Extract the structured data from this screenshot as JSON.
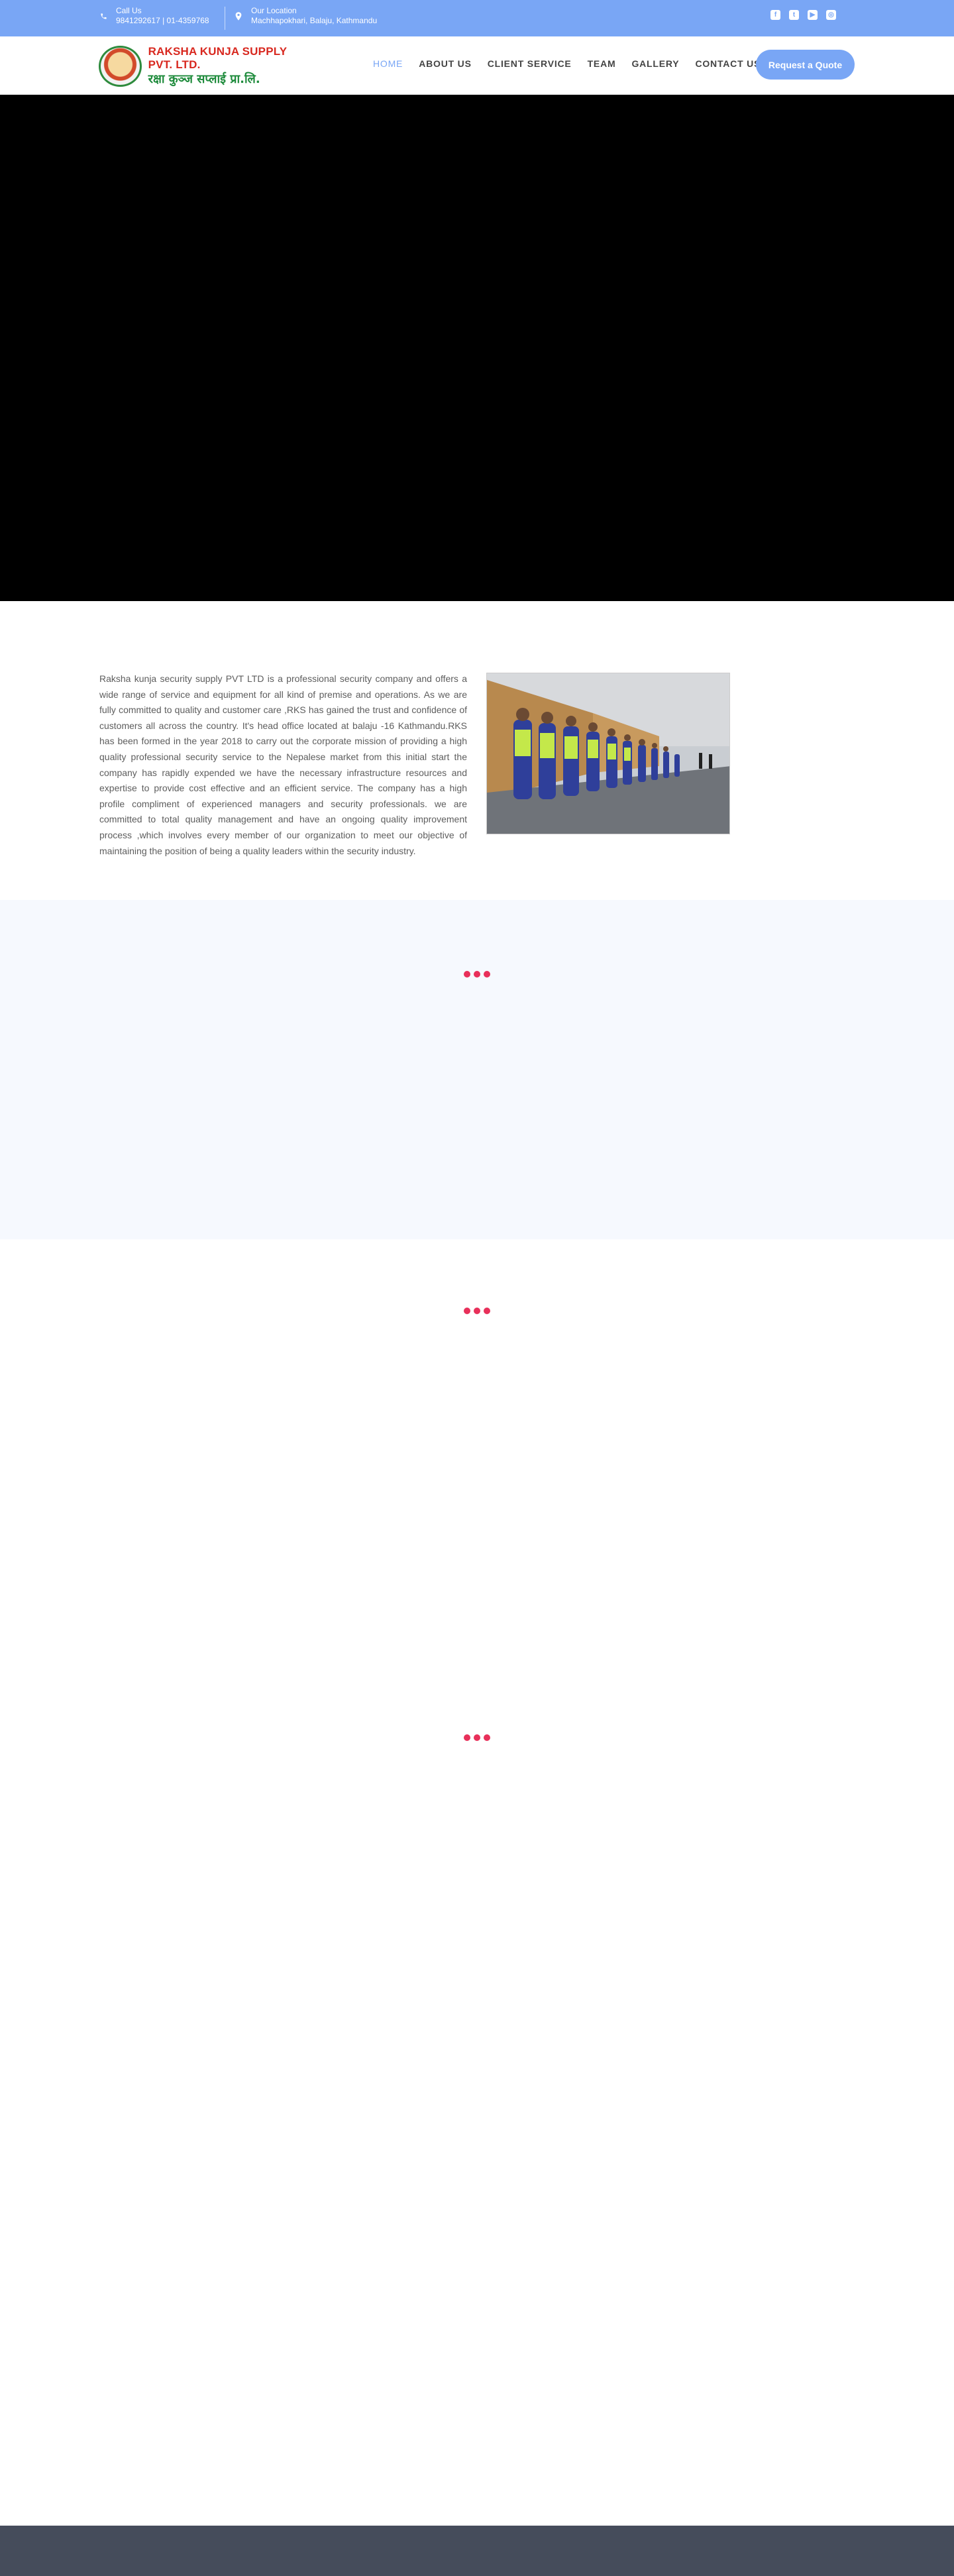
{
  "topbar": {
    "call": {
      "icon": "phone-icon",
      "label": "Call Us",
      "value": "9841292617 | 01-4359768"
    },
    "location": {
      "icon": "map-pin-icon",
      "label": "Our Location",
      "value": "Machhapokhari, Balaju, Kathmandu"
    },
    "socials": [
      {
        "name": "facebook-icon",
        "glyph": "f"
      },
      {
        "name": "twitter-icon",
        "glyph": "t"
      },
      {
        "name": "youtube-icon",
        "glyph": "▶"
      },
      {
        "name": "instagram-icon",
        "glyph": "◎"
      }
    ]
  },
  "header": {
    "logo": {
      "title_en": "RAKSHA KUNJA SUPPLY PVT. LTD.",
      "title_np": "रक्षा कुञ्ज सप्लाई प्रा.लि."
    },
    "nav": [
      "HOME",
      "ABOUT US",
      "CLIENT SERVICE",
      "TEAM",
      "GALLERY",
      "CONTACT US"
    ],
    "active_nav": "HOME",
    "quote_button": "Request a Quote"
  },
  "about": {
    "paragraph": "Raksha  kunja security supply  PVT LTD  is a professional security company and offers   a wide range of service and equipment for all kind of premise and operations. As we are fully committed to quality and customer care ,RKS has gained the trust and confidence of customers all across the country. It's head office located at balaju -16 Kathmandu.RKS has been formed in the year 2018 to carry out the corporate  mission of providing a high quality professional security service to the Nepalese market from this initial start the company has rapidly expended  we have the necessary infrastructure resources and expertise to provide cost effective and an efficient service. The company has a high profile compliment of experienced managers and security professionals. we are committed to total quality   management and have an ongoing quality improvement process ,which involves every member of our organization to  meet our objective of maintaining the position of being a quality  leaders within the security industry."
  },
  "colors": {
    "accent": "#79a6f5",
    "loader": "#e8305a",
    "footer": "#454c5b",
    "section_bg": "#f6f9fe"
  }
}
